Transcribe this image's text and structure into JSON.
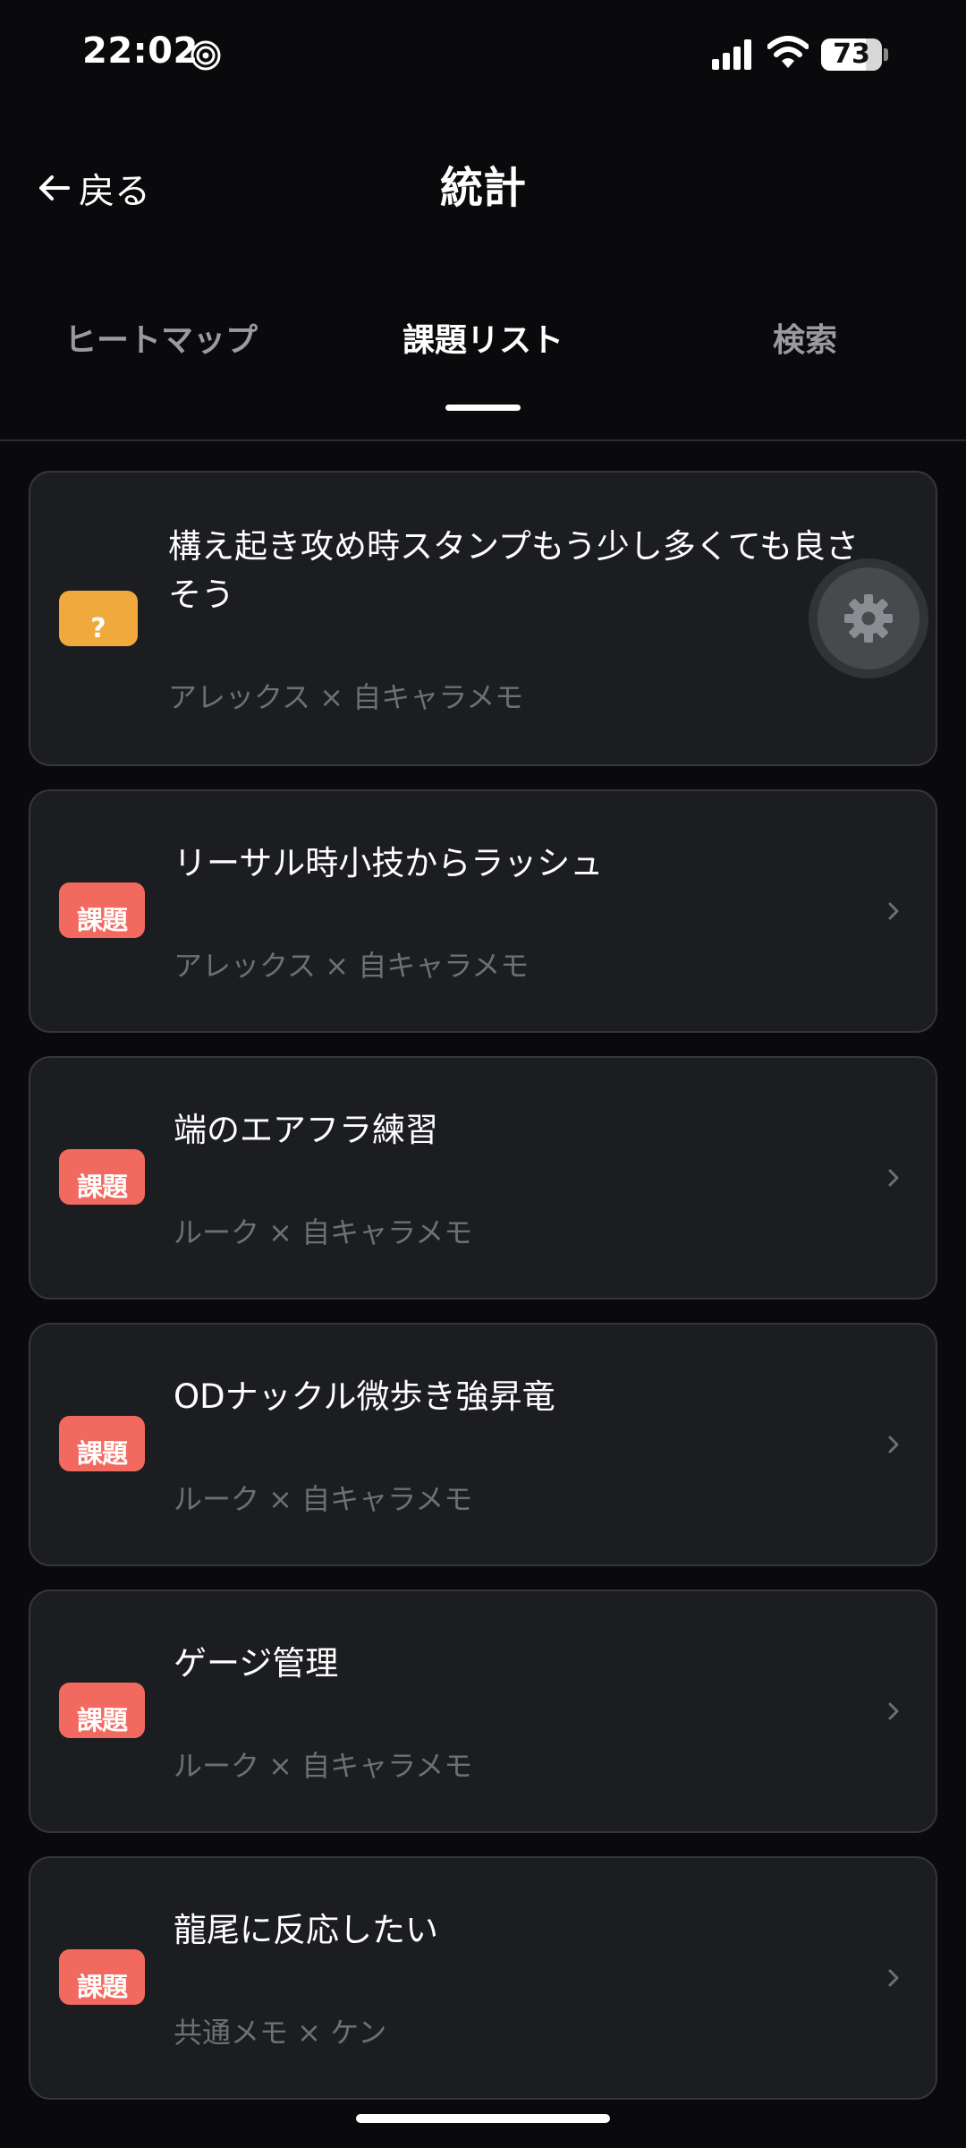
{
  "status_bar": {
    "time": "22:02",
    "battery_percent": 73,
    "battery_label": "73"
  },
  "header": {
    "back_label": "戻る",
    "title": "統計"
  },
  "tabs": [
    {
      "label": "ヒートマップ",
      "active": false
    },
    {
      "label": "課題リスト",
      "active": true
    },
    {
      "label": "検索",
      "active": false
    }
  ],
  "issues": [
    {
      "badge": "?",
      "badge_type": "question",
      "title": "構え起き攻め時スタンプもう少し多くても良さそう",
      "subtitle": "アレックス × 自キャラメモ"
    },
    {
      "badge": "課題",
      "badge_type": "task",
      "title": "リーサル時小技からラッシュ",
      "subtitle": "アレックス × 自キャラメモ"
    },
    {
      "badge": "課題",
      "badge_type": "task",
      "title": "端のエアフラ練習",
      "subtitle": "ルーク × 自キャラメモ"
    },
    {
      "badge": "課題",
      "badge_type": "task",
      "title": "ODナックル微歩き強昇竜",
      "subtitle": "ルーク × 自キャラメモ"
    },
    {
      "badge": "課題",
      "badge_type": "task",
      "title": "ゲージ管理",
      "subtitle": "ルーク × 自キャラメモ"
    },
    {
      "badge": "課題",
      "badge_type": "task",
      "title": "龍尾に反応したい",
      "subtitle": "共通メモ × ケン"
    }
  ],
  "colors": {
    "background": "#0a0a0c",
    "card": "#1c1d21",
    "task_badge": "#f26a5f",
    "question_badge": "#f0a93b",
    "subtitle": "#6e6f75"
  }
}
